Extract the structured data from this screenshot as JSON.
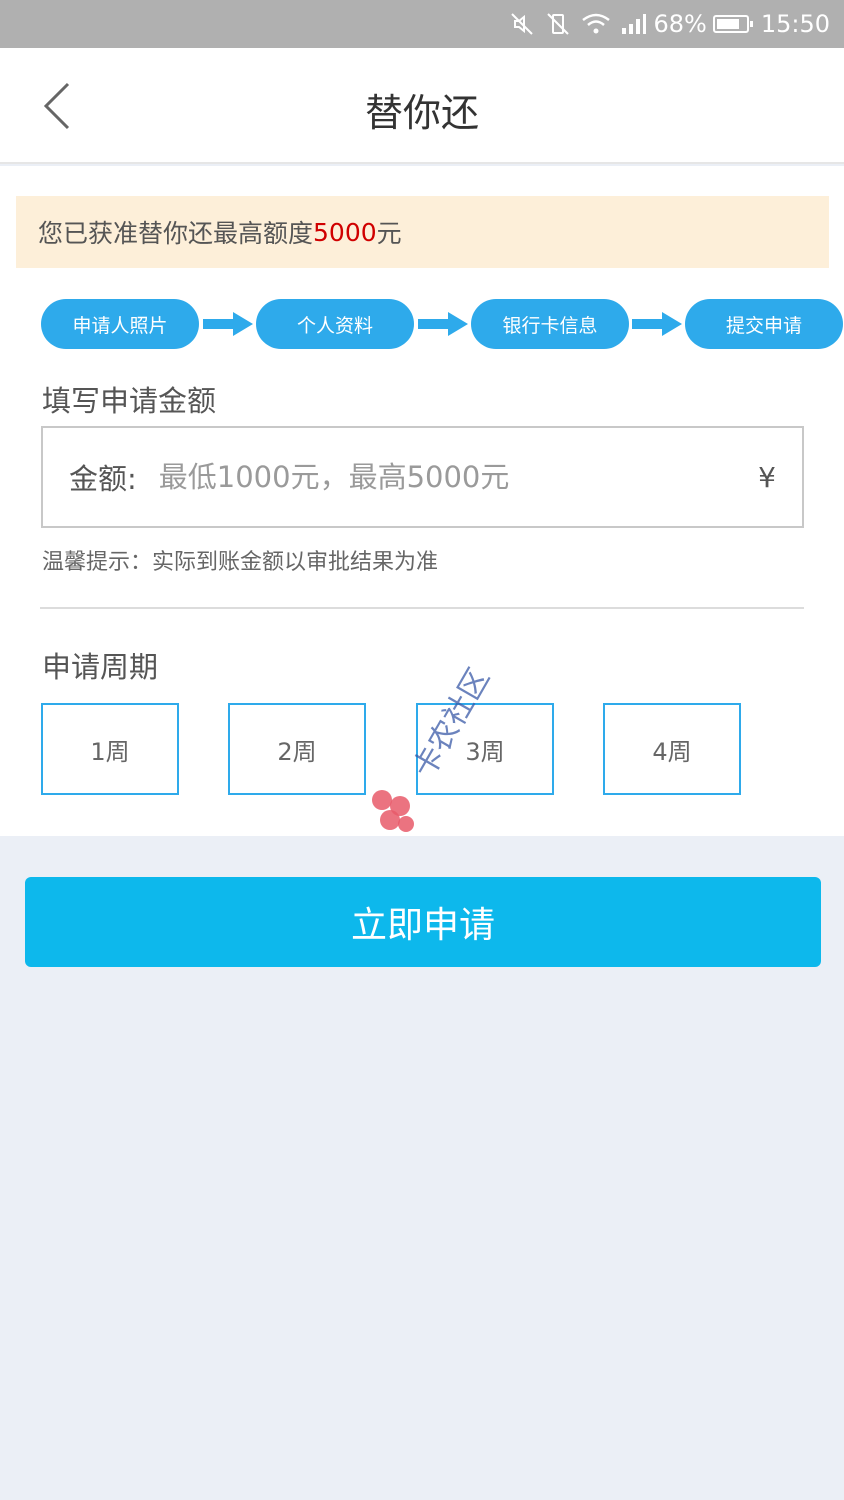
{
  "status_bar": {
    "battery": "68%",
    "time": "15:50"
  },
  "header": {
    "title": "替你还"
  },
  "notice": {
    "prefix": "您已获准替你还最高额度",
    "amount": "5000",
    "suffix": "元"
  },
  "steps": [
    {
      "label": "申请人照片"
    },
    {
      "label": "个人资料"
    },
    {
      "label": "银行卡信息"
    },
    {
      "label": "提交申请"
    }
  ],
  "amount_section": {
    "title": "填写申请金额",
    "field_label": "金额:",
    "placeholder": "最低1000元，最高5000元",
    "currency": "¥",
    "tip": "温馨提示：实际到账金额以审批结果为准"
  },
  "period_section": {
    "title": "申请周期",
    "options": [
      {
        "label": "1周"
      },
      {
        "label": "2周"
      },
      {
        "label": "3周"
      },
      {
        "label": "4周"
      }
    ]
  },
  "watermark": {
    "text": "卡农社区"
  },
  "submit": {
    "label": "立即申请"
  },
  "colors": {
    "accent": "#2eaaeb",
    "button": "#0db8ec",
    "notice_bg": "#fdefd9",
    "highlight": "#d00000"
  }
}
